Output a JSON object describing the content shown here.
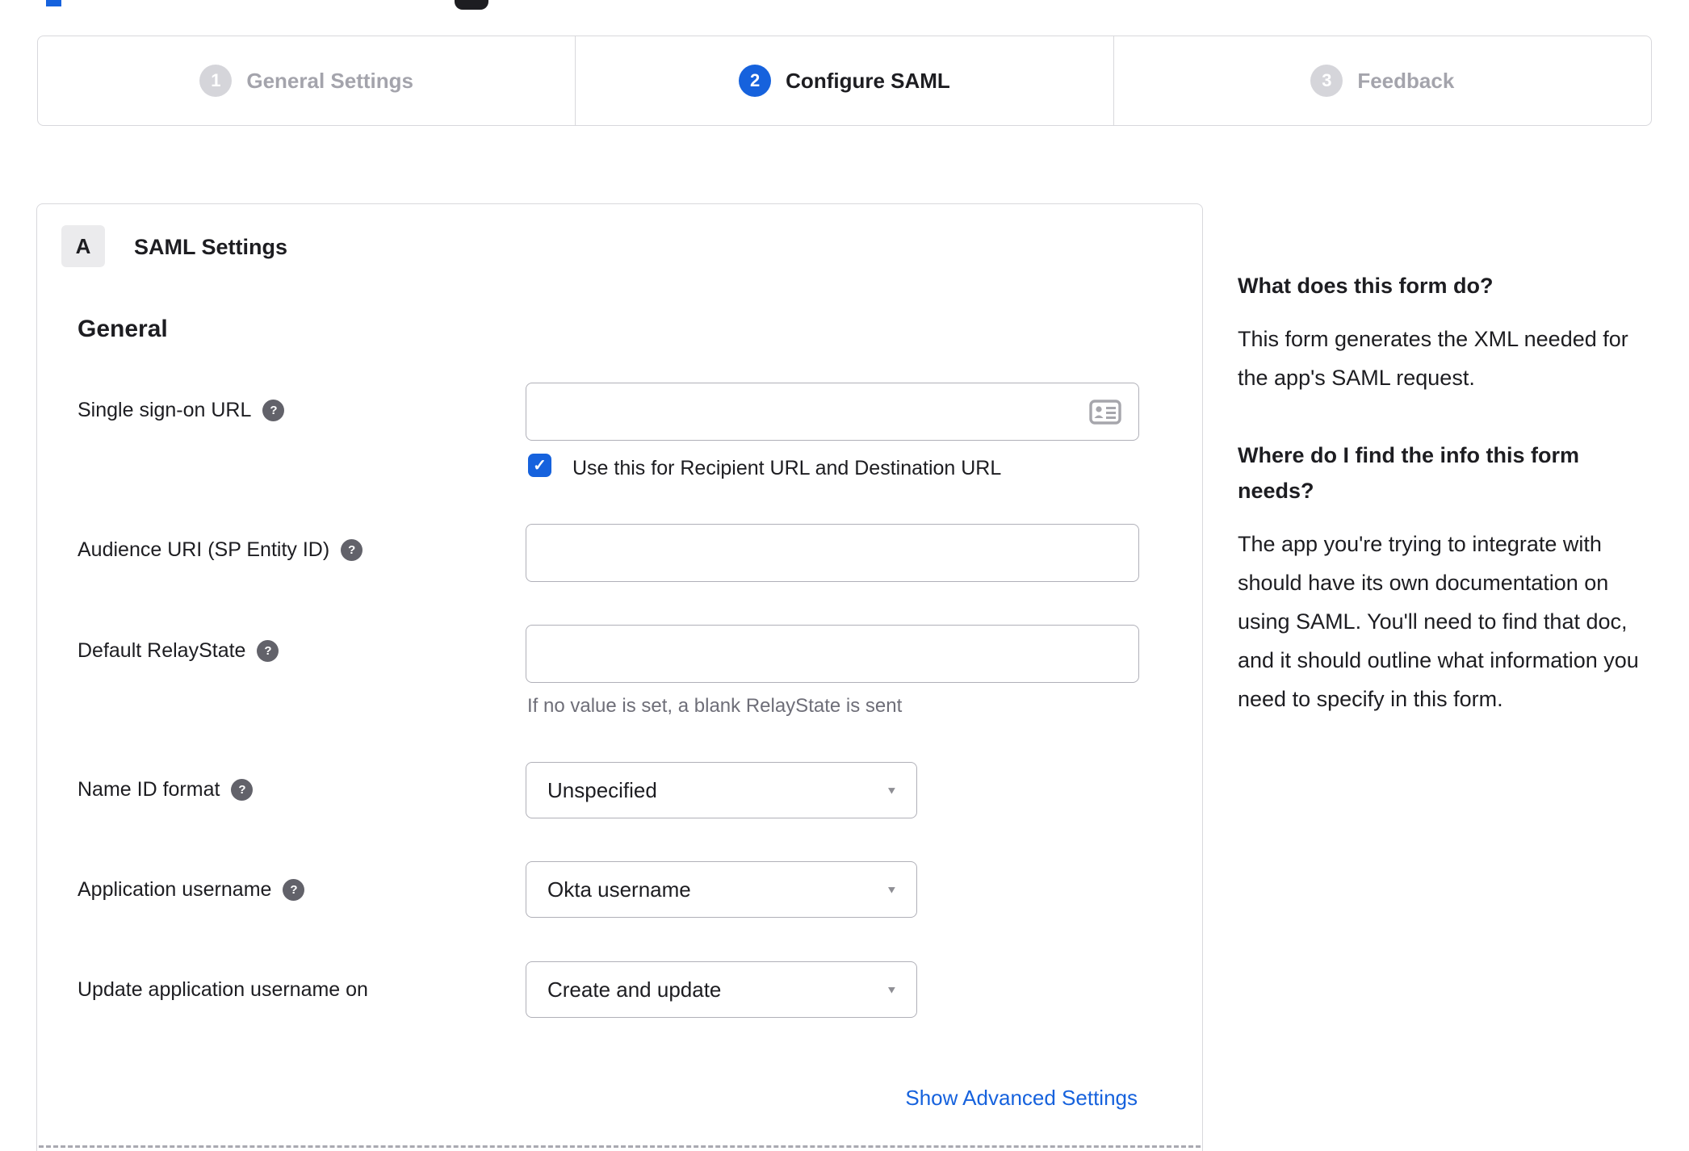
{
  "stepper": {
    "steps": [
      {
        "number": "1",
        "label": "General Settings",
        "state": "inactive"
      },
      {
        "number": "2",
        "label": "Configure SAML",
        "state": "active"
      },
      {
        "number": "3",
        "label": "Feedback",
        "state": "inactive"
      }
    ]
  },
  "panel": {
    "badge": "A",
    "title": "SAML Settings",
    "section": "General",
    "fields": {
      "sso_url": {
        "label": "Single sign-on URL",
        "value": "",
        "checkbox": {
          "checked": true,
          "label": "Use this for Recipient URL and Destination URL"
        }
      },
      "audience_uri": {
        "label": "Audience URI (SP Entity ID)",
        "value": ""
      },
      "relay_state": {
        "label": "Default RelayState",
        "value": "",
        "hint": "If no value is set, a blank RelayState is sent"
      },
      "name_id_format": {
        "label": "Name ID format",
        "value": "Unspecified"
      },
      "app_username": {
        "label": "Application username",
        "value": "Okta username"
      },
      "update_username": {
        "label": "Update application username on",
        "value": "Create and update"
      }
    },
    "advanced_link": "Show Advanced Settings"
  },
  "help_panel": {
    "q1_title": "What does this form do?",
    "q1_body": "This form generates the XML needed for the app's SAML request.",
    "q2_title": "Where do I find the info this form needs?",
    "q2_body": "The app you're trying to integrate with should have its own documentation on using SAML. You'll need to find that doc, and it should outline what information you need to specify in this form."
  },
  "icons": {
    "help": "?",
    "caret": "▼",
    "check": "✓"
  },
  "colors": {
    "accent_blue": "#1662dd",
    "text_dark": "#1d1d21",
    "inactive_gray": "#a4a4ac",
    "hint_gray": "#6e6e78",
    "border_light": "#d8d8dc",
    "input_border": "#b0b0b8"
  }
}
